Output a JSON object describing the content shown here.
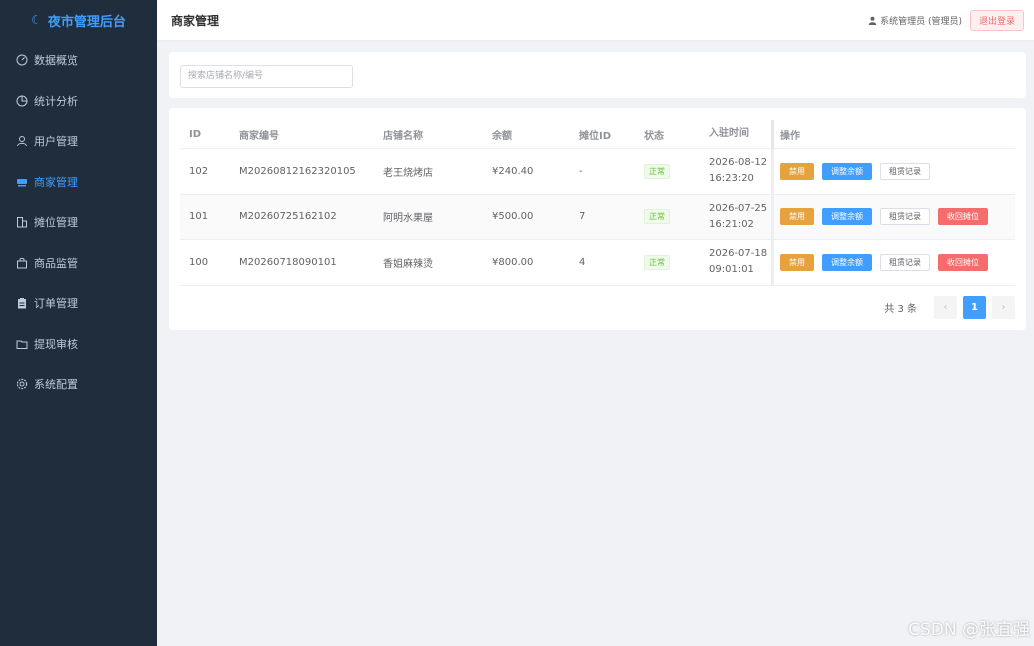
{
  "app": {
    "brand": "夜市管理后台",
    "brand_icon": "moon-icon",
    "accent": "#409eff"
  },
  "sidebar": {
    "items": [
      {
        "label": "数据概览",
        "icon": "dashboard-icon",
        "active": false
      },
      {
        "label": "统计分析",
        "icon": "pie-chart-icon",
        "active": false
      },
      {
        "label": "用户管理",
        "icon": "user-icon",
        "active": false
      },
      {
        "label": "商家管理",
        "icon": "shop-icon",
        "active": true
      },
      {
        "label": "摊位管理",
        "icon": "building-icon",
        "active": false
      },
      {
        "label": "商品监管",
        "icon": "bag-icon",
        "active": false
      },
      {
        "label": "订单管理",
        "icon": "clipboard-icon",
        "active": false
      },
      {
        "label": "提现审核",
        "icon": "folder-icon",
        "active": false
      },
      {
        "label": "系统配置",
        "icon": "gear-icon",
        "active": false
      }
    ]
  },
  "header": {
    "title": "商家管理",
    "user": "系统管理员 (管理员)",
    "logout": "退出登录"
  },
  "search": {
    "placeholder": "搜索店铺名称/编号"
  },
  "table": {
    "columns": [
      "ID",
      "商家编号",
      "店铺名称",
      "余额",
      "摊位ID",
      "状态",
      "入驻时间",
      "操作"
    ],
    "rows": [
      {
        "id": "102",
        "no": "M20260812162320105",
        "shop": "老王烧烤店",
        "balance": "¥240.40",
        "stall": "-",
        "status": "正常",
        "date": "2026-08-12",
        "time": "16:23:20"
      },
      {
        "id": "101",
        "no": "M20260725162102",
        "shop": "阿明水果屋",
        "balance": "¥500.00",
        "stall": "7",
        "status": "正常",
        "date": "2026-07-25",
        "time": "16:21:02"
      },
      {
        "id": "100",
        "no": "M20260718090101",
        "shop": "香姐麻辣烫",
        "balance": "¥800.00",
        "stall": "4",
        "status": "正常",
        "date": "2026-07-18",
        "time": "09:01:01"
      }
    ],
    "actions": {
      "disable": "禁用",
      "adjust": "调整余额",
      "rent": "租赁记录",
      "reclaim": "收回摊位"
    }
  },
  "pagination": {
    "total": "共 3 条",
    "page": "1",
    "prev": "‹",
    "next": "›"
  },
  "watermark": "CSDN @张宜强"
}
